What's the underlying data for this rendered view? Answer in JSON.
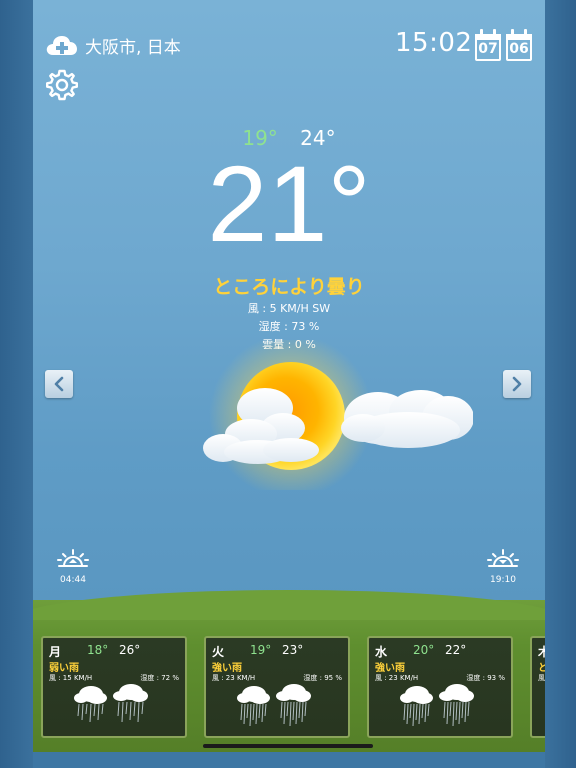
{
  "header": {
    "location": "大阪市, 日本",
    "time": "15:02",
    "calendar_month": "07",
    "calendar_day": "06"
  },
  "current": {
    "temp_min": "19°",
    "temp_max": "24°",
    "temperature": "21°",
    "condition": "ところにより曇り",
    "wind": "風 : 5 KM/H SW",
    "humidity": "湿度 : 73 %",
    "cloud_cover": "雲量 : 0 %"
  },
  "sun": {
    "sunrise": "04:44",
    "sunset": "19:10"
  },
  "forecast": [
    {
      "day": "月",
      "min": "18°",
      "max": "26°",
      "condition": "弱い雨",
      "wind": "風 : 15 KM/H",
      "humidity": "湿度 : 72 %"
    },
    {
      "day": "火",
      "min": "19°",
      "max": "23°",
      "condition": "強い雨",
      "wind": "風 : 23 KM/H",
      "humidity": "湿度 : 95 %"
    },
    {
      "day": "水",
      "min": "20°",
      "max": "22°",
      "condition": "強い雨",
      "wind": "風 : 23 KM/H",
      "humidity": "湿度 : 93 %"
    },
    {
      "day": "木",
      "min": "",
      "max": "",
      "condition": "と",
      "wind": "風",
      "humidity": ""
    }
  ],
  "colors": {
    "sky_top": "#7ab2d6",
    "sky_bottom": "#5a96bf",
    "min_temp": "#8fe28f",
    "condition": "#ffd23a",
    "grass": "#6f9e3b",
    "card_border": "#8aa45a"
  },
  "icons": {
    "location": "cloud-plus-icon",
    "calendar": "calendar-icon",
    "settings": "gear-icon",
    "prev": "chevron-left-icon",
    "next": "chevron-right-icon",
    "sunrise": "sunrise-icon",
    "sunset": "sunset-icon",
    "weather": "sun-with-clouds-icon",
    "rain": "rain-cloud-icon"
  }
}
